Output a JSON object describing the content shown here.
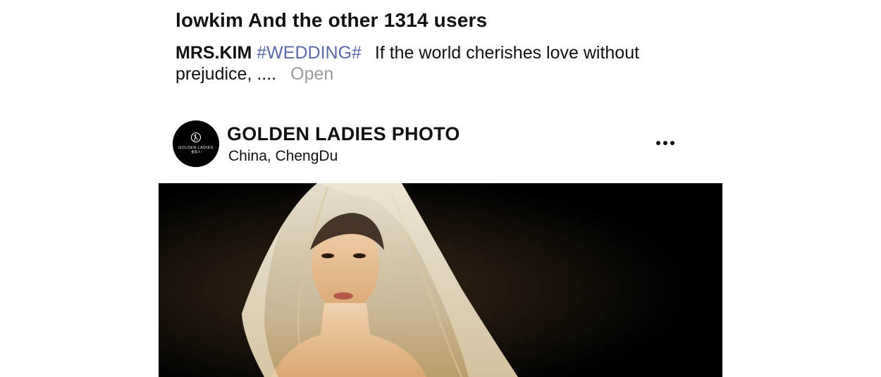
{
  "likes": {
    "text": "lowkim And the other 1314 users"
  },
  "caption": {
    "author": "MRS.KIM",
    "hashtag": "#WEDDING#",
    "text_line": "If the world cherishes love without prejudice, ....",
    "open_label": "Open"
  },
  "post": {
    "account_name": "GOLDEN LADIES PHOTO",
    "location": "China,  ChengDu",
    "avatar_text": "GOLDEN LADIES",
    "avatar_subtext": "金夫人",
    "more_icon": "more-horizontal-icon",
    "photo_alt": "bride-with-veil-photo"
  }
}
